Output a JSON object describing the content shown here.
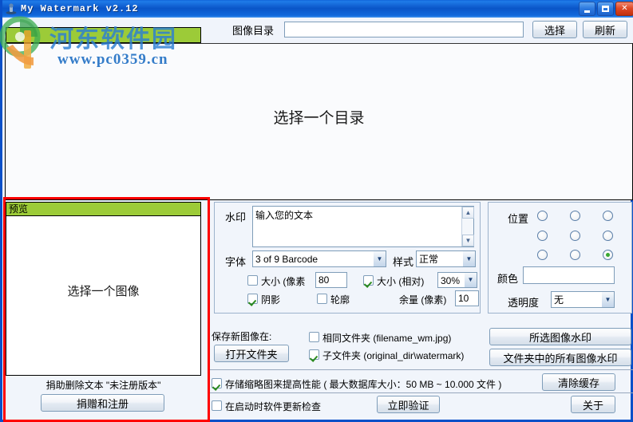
{
  "window": {
    "title": "My Watermark v2.12",
    "icon": "stamp-icon",
    "buttons": {
      "minimize": "_",
      "maximize": "□",
      "close": "✕"
    }
  },
  "toolbar": {
    "dir_label": "图像目录",
    "dir_value": "",
    "dir_placeholder": "",
    "select_label": "选择",
    "refresh_label": "刷新"
  },
  "image_area": {
    "message": "选择一个目录"
  },
  "preview": {
    "header": "预览",
    "message": "选择一个图像",
    "donate_text": "捐助删除文本 \"未注册版本\"",
    "donate_button": "捐赠和注册"
  },
  "watermark": {
    "label": "水印",
    "text_value": "输入您的文本",
    "font_label": "字体",
    "font_value": "3 of 9 Barcode",
    "style_label": "样式",
    "style_value": "正常",
    "size_px_label": "大小 (像素",
    "size_px_checked": false,
    "size_px_value": "80",
    "size_rel_label": "大小 (相对)",
    "size_rel_checked": true,
    "size_rel_value": "30%",
    "shadow_label": "阴影",
    "shadow_checked": true,
    "outline_label": "轮廓",
    "outline_checked": false,
    "margin_label": "余量 (像素)",
    "margin_value": "10"
  },
  "position": {
    "label": "位置",
    "selected_index": 8,
    "color_label": "颜色",
    "color_value": "#ffffff",
    "alpha_label": "透明度",
    "alpha_value": "无"
  },
  "save": {
    "label": "保存新图像在:",
    "open_folder_button": "打开文件夹",
    "same_folder_label": "相同文件夹 (filename_wm.jpg)",
    "same_folder_checked": false,
    "sub_folder_label": "子文件夹 (original_dir\\watermark)",
    "sub_folder_checked": true,
    "watermark_selected_button": "所选图像水印",
    "watermark_all_button": "文件夹中的所有图像水印"
  },
  "bottom": {
    "thumbs_label": "存储缩略图来提高性能 ( 最大数据库大小：50 MB ~ 10.000 文件 )",
    "thumbs_checked": true,
    "clear_cache_button": "清除缓存",
    "update_label": "在启动时软件更新检查",
    "update_checked": false,
    "verify_button": "立即验证",
    "about_button": "关于"
  },
  "overlay_watermark": {
    "site_name": "河东软件园",
    "url": "www.pc0359.cn"
  },
  "colors": {
    "titlebar_blue": "#0a55c8",
    "green_header": "#9ccb38",
    "highlight_red": "#ff0000",
    "radio_green": "#3aa832"
  }
}
